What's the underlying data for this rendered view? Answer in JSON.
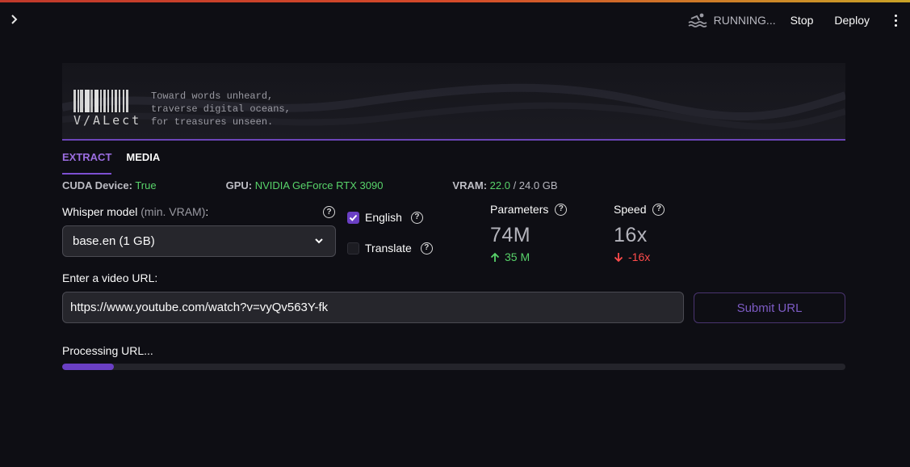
{
  "header": {
    "status_text": "RUNNING...",
    "stop_label": "Stop",
    "deploy_label": "Deploy"
  },
  "banner": {
    "logo_text": "V/ALect",
    "tagline": [
      "Toward words unheard,",
      "traverse digital oceans,",
      "for treasures unseen."
    ]
  },
  "tabs": [
    {
      "label": "EXTRACT",
      "active": true
    },
    {
      "label": "MEDIA",
      "active": false
    }
  ],
  "device_info": {
    "cuda_label": "CUDA Device:",
    "cuda_value": "True",
    "gpu_label": "GPU:",
    "gpu_value": "NVIDIA GeForce RTX 3090",
    "vram_label": "VRAM:",
    "vram_used": "22.0",
    "vram_total": " / 24.0 GB"
  },
  "model": {
    "label": "Whisper model",
    "label_hint": "(min. VRAM)",
    "label_suffix": ":",
    "selected": "base.en (1 GB)"
  },
  "options": [
    {
      "label": "English",
      "checked": true
    },
    {
      "label": "Translate",
      "checked": false
    }
  ],
  "metrics": [
    {
      "label": "Parameters",
      "value": "74M",
      "delta": "35 M",
      "direction": "up"
    },
    {
      "label": "Speed",
      "value": "16x",
      "delta": "-16x",
      "direction": "down"
    }
  ],
  "url": {
    "label": "Enter a video URL:",
    "value": "https://www.youtube.com/watch?v=vyQv563Y-fk",
    "submit_label": "Submit URL"
  },
  "processing": {
    "label": "Processing URL...",
    "progress": 0.066
  },
  "colors": {
    "accent": "#7d4fd1",
    "success": "#58d36a",
    "danger": "#ff4b4b",
    "background": "#0e0e14"
  }
}
